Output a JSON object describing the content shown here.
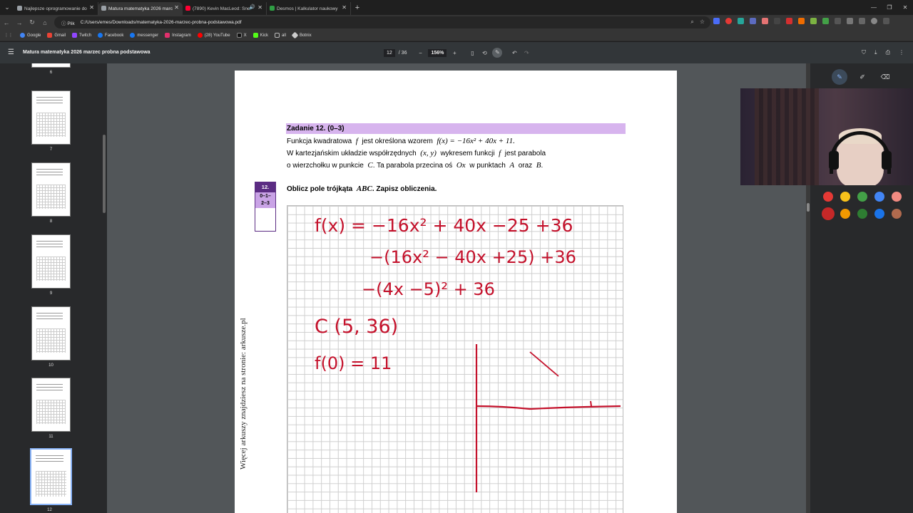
{
  "tabs": [
    {
      "label": "Najlepsze oprogramowanie do",
      "fav_color": "#9aa0a6",
      "active": false
    },
    {
      "label": "Matura matematyka 2026 marc",
      "fav_color": "#9aa0a6",
      "active": true
    },
    {
      "label": "(7890) Kevin MacLeod: Sne",
      "fav_color": "#ff0033",
      "active": false
    },
    {
      "label": "Desmos | Kalkulator naukowy",
      "fav_color": "#2f9e44",
      "active": false
    }
  ],
  "address": {
    "chip": "Plik",
    "url": "C:/Users/emes/Downloads/matematyka-2026-marzec-probna-podstawowa.pdf"
  },
  "bookmarks": [
    {
      "label": "Google",
      "color": "#4285f4"
    },
    {
      "label": "Gmail",
      "color": "#ea4335"
    },
    {
      "label": "Twitch",
      "color": "#9146ff"
    },
    {
      "label": "Facebook",
      "color": "#1877f2"
    },
    {
      "label": "messenger",
      "color": "#1877f2"
    },
    {
      "label": "Instagram",
      "color": "#e1306c"
    },
    {
      "label": "(28) YouTube",
      "color": "#ff0000"
    },
    {
      "label": "X",
      "color": "#000000"
    },
    {
      "label": "Kick",
      "color": "#53fc18"
    },
    {
      "label": "all",
      "color": "#9aa0a6"
    },
    {
      "label": "Botnix",
      "color": "#cccccc"
    }
  ],
  "pdf": {
    "title": "Matura matematyka 2026 marzec probna podstawowa",
    "page_current": "12",
    "page_total": "/ 36",
    "zoom": "156%"
  },
  "thumbnails": [
    {
      "num": "6"
    },
    {
      "num": "7"
    },
    {
      "num": "8"
    },
    {
      "num": "9"
    },
    {
      "num": "10"
    },
    {
      "num": "11"
    },
    {
      "num": "12"
    }
  ],
  "page": {
    "side_text": "Więcej arkuszy znajdziesz na stronie: arkusze.pl",
    "task_header": "Zadanie 12. (0–3)",
    "line1_a": "Funkcja kwadratowa",
    "line1_f": "f",
    "line1_b": "jest określona wzorem",
    "line1_formula": "f(x) = −16x² + 40x + 11.",
    "line2_a": "W kartezjańskim układzie współrzędnych",
    "line2_xy": "(x, y)",
    "line2_b": "wykresem funkcji",
    "line2_f": "f",
    "line2_c": "jest parabola",
    "line3_a": "o wierzchołku w punkcie",
    "line3_c": "C",
    "line3_b": ". Ta parabola przecina oś",
    "line3_ox": "Ox",
    "line3_d": "w punktach",
    "line3_A": "A",
    "line3_e": "oraz",
    "line3_B": "B",
    "line3_end": ".",
    "score_num": "12.",
    "score_range_1": "0–1–",
    "score_range_2": "2–3",
    "question_a": "Oblicz pole trójkąta",
    "question_abc": "ABC",
    "question_b": ". Zapisz obliczenia."
  },
  "handwriting": {
    "line1": "f(x) = −16x² + 40x −25 +36",
    "line2": "−(16x² − 40x +25) +36",
    "line3": "−(4x −5)² + 36",
    "line4": "C (5, 36)",
    "line5": "f(0) = 11",
    "ink_color": "#c4112b"
  },
  "annotation_colors": {
    "row1": [
      "#e53935",
      "#f9c21b",
      "#43a047",
      "#4285f4",
      "#f28b82"
    ],
    "row2": [
      "#c62828",
      "#f29900",
      "#2e7d32",
      "#1a73e8",
      "#b06a4e"
    ]
  }
}
